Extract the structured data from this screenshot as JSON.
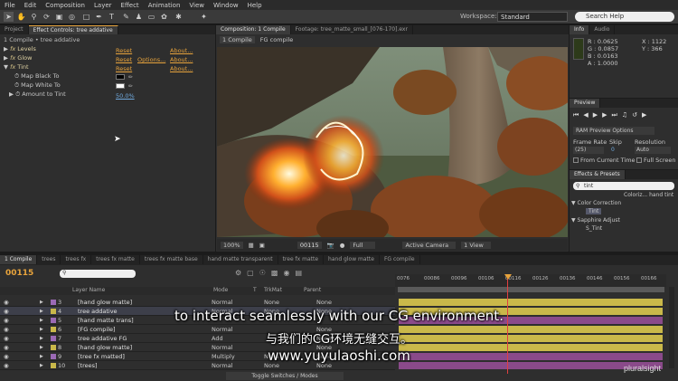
{
  "menu": [
    "File",
    "Edit",
    "Composition",
    "Layer",
    "Effect",
    "Animation",
    "View",
    "Window",
    "Help"
  ],
  "toolbar": {
    "workspace_label": "Workspace:",
    "workspace_value": "Standard",
    "search_placeholder": "Search Help"
  },
  "left_panel": {
    "tabs": [
      "Project",
      "Effect Controls: tree addative"
    ],
    "breadcrumb": "1 Compile • tree addative",
    "effects": [
      {
        "name": "Levels",
        "reset": "Reset",
        "about": "About..."
      },
      {
        "name": "Glow",
        "reset": "Reset",
        "options": "Options...",
        "about": "About..."
      },
      {
        "name": "Tint",
        "reset": "Reset",
        "about": "About..."
      }
    ],
    "tint_props": {
      "map_black": "Map Black To",
      "map_white": "Map White To",
      "amount": "Amount to Tint",
      "amount_value": "50.0%"
    }
  },
  "comp_panel": {
    "tabs": [
      "Composition: 1 Compile",
      "Footage: tree_matte_small_[076-170].exr"
    ],
    "sub_tabs": [
      "1 Compile",
      "FG compile"
    ],
    "zoom": "100%",
    "timecode": "00115",
    "resolution": "Full",
    "camera": "Active Camera",
    "view": "1 View"
  },
  "info_panel": {
    "tabs": [
      "Info",
      "Audio"
    ],
    "r": "R : 0.0625",
    "g": "G : 0.0857",
    "b": "B : 0.0163",
    "a": "A : 1.0000",
    "x": "X : 1122",
    "y": "Y : 366"
  },
  "preview_panel": {
    "title": "Preview",
    "ram": "RAM Preview Options",
    "frame_rate_label": "Frame Rate",
    "skip_label": "Skip",
    "resolution_label": "Resolution",
    "frame_rate": "(25)",
    "skip": "0",
    "resolution": "Auto",
    "from_current": "From Current Time",
    "full_screen": "Full Screen"
  },
  "effects_panel": {
    "title": "Effects & Presets",
    "search": "tint",
    "items": [
      {
        "label": "Coloriz... hand tint",
        "type": "item"
      },
      {
        "label": "Color Correction",
        "type": "group"
      },
      {
        "label": "Tint",
        "type": "item",
        "selected": true
      },
      {
        "label": "Sapphire Adjust",
        "type": "group"
      },
      {
        "label": "S_Tint",
        "type": "item"
      }
    ]
  },
  "timeline": {
    "tabs": [
      "1 Compile",
      "trees",
      "trees fx",
      "trees fx matte",
      "trees fx matte base",
      "hand matte transparent",
      "tree fx matte",
      "hand glow matte",
      "FG compile"
    ],
    "timecode": "00115",
    "col_layer_name": "Layer Name",
    "col_mode": "Mode",
    "col_t": "T",
    "col_trkmat": "TrkMat",
    "col_parent": "Parent",
    "ruler": [
      "0076",
      "00086",
      "00096",
      "00106",
      "00116",
      "00126",
      "00136",
      "00146",
      "00156",
      "00166"
    ],
    "layers": [
      {
        "num": "3",
        "name": "[hand glow matte]",
        "mode": "Normal",
        "trkmat": "None",
        "parent": "None"
      },
      {
        "num": "4",
        "name": "tree addative",
        "mode": "Normal",
        "trkmat": "None",
        "parent": "None"
      },
      {
        "num": "5",
        "name": "[hand matte trans]",
        "mode": "",
        "trkmat": "",
        "parent": ""
      },
      {
        "num": "6",
        "name": "[FG compile]",
        "mode": "Normal",
        "trkmat": "",
        "parent": "None"
      },
      {
        "num": "7",
        "name": "tree addative FG",
        "mode": "Add",
        "trkmat": "",
        "parent": "None"
      },
      {
        "num": "8",
        "name": "[hand glow matte]",
        "mode": "Normal",
        "trkmat": "",
        "parent": "None"
      },
      {
        "num": "9",
        "name": "[tree fx matted]",
        "mode": "Multiply",
        "trkmat": "None",
        "parent": "None"
      },
      {
        "num": "10",
        "name": "[trees]",
        "mode": "Normal",
        "trkmat": "None",
        "parent": "None"
      }
    ],
    "toggle_label": "Toggle Switches / Modes"
  },
  "subtitles": {
    "en": "to interact seamlessly with our CG environment.",
    "zh": "与我们的CG环境无缝交互。",
    "url": "www.yuyulaoshi.com"
  },
  "watermark": "pluralsight",
  "colors": {
    "accent_orange": "#e7a33c",
    "track_yellow": "#c9b84a",
    "track_purple": "#8a4a8a",
    "playhead": "#e04040"
  }
}
